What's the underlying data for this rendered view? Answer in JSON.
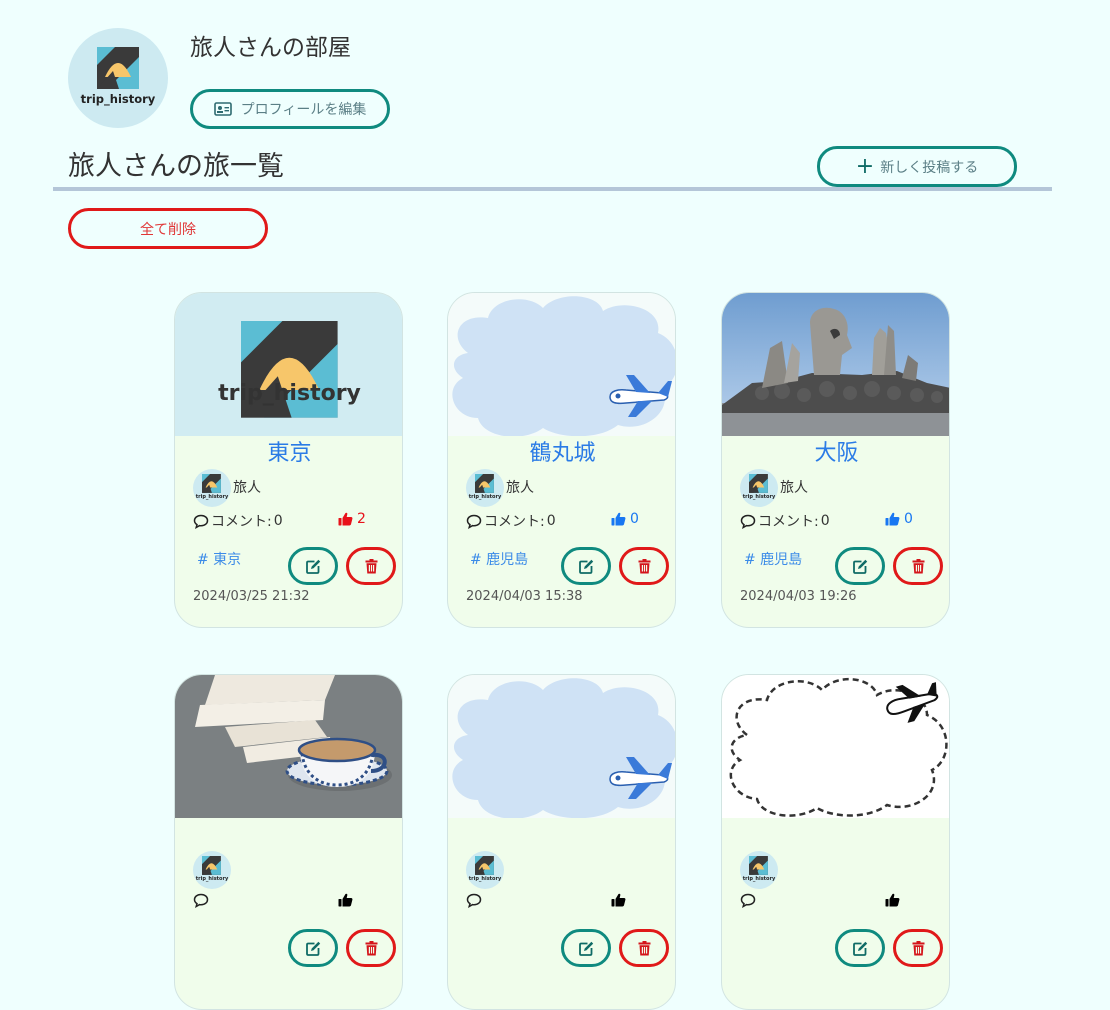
{
  "profile": {
    "logo_text": "trip_history",
    "room_title": "旅人さんの部屋",
    "edit_button": "プロフィールを編集"
  },
  "list": {
    "title": "旅人さんの旅一覧",
    "new_post_button": "新しく投稿する",
    "delete_all_button": "全て削除"
  },
  "cards": [
    {
      "title": "東京",
      "user": "旅人",
      "comment_label": "コメント:",
      "comments": "0",
      "likes": "2",
      "like_color": "#e8111a",
      "tag": "# 東京",
      "date": "2024/03/25 21:32",
      "thumb": "logo"
    },
    {
      "title": "鶴丸城",
      "user": "旅人",
      "comment_label": "コメント:",
      "comments": "0",
      "likes": "0",
      "like_color": "#1877f2",
      "tag": "# 鹿児島",
      "date": "2024/04/03 15:38",
      "thumb": "cloud-plane"
    },
    {
      "title": "大阪",
      "user": "旅人",
      "comment_label": "コメント:",
      "comments": "0",
      "likes": "0",
      "like_color": "#1877f2",
      "tag": "# 鹿児島",
      "date": "2024/04/03 19:26",
      "thumb": "stone-monument"
    },
    {
      "thumb": "tea-books"
    },
    {
      "thumb": "cloud-plane"
    },
    {
      "thumb": "dashed-cloud-plane"
    }
  ],
  "colors": {
    "background": "#effffe",
    "accent": "#0f8a7f",
    "danger": "#e01919",
    "title_blue": "#2a7be6",
    "card_body": "#f0fdeb"
  }
}
